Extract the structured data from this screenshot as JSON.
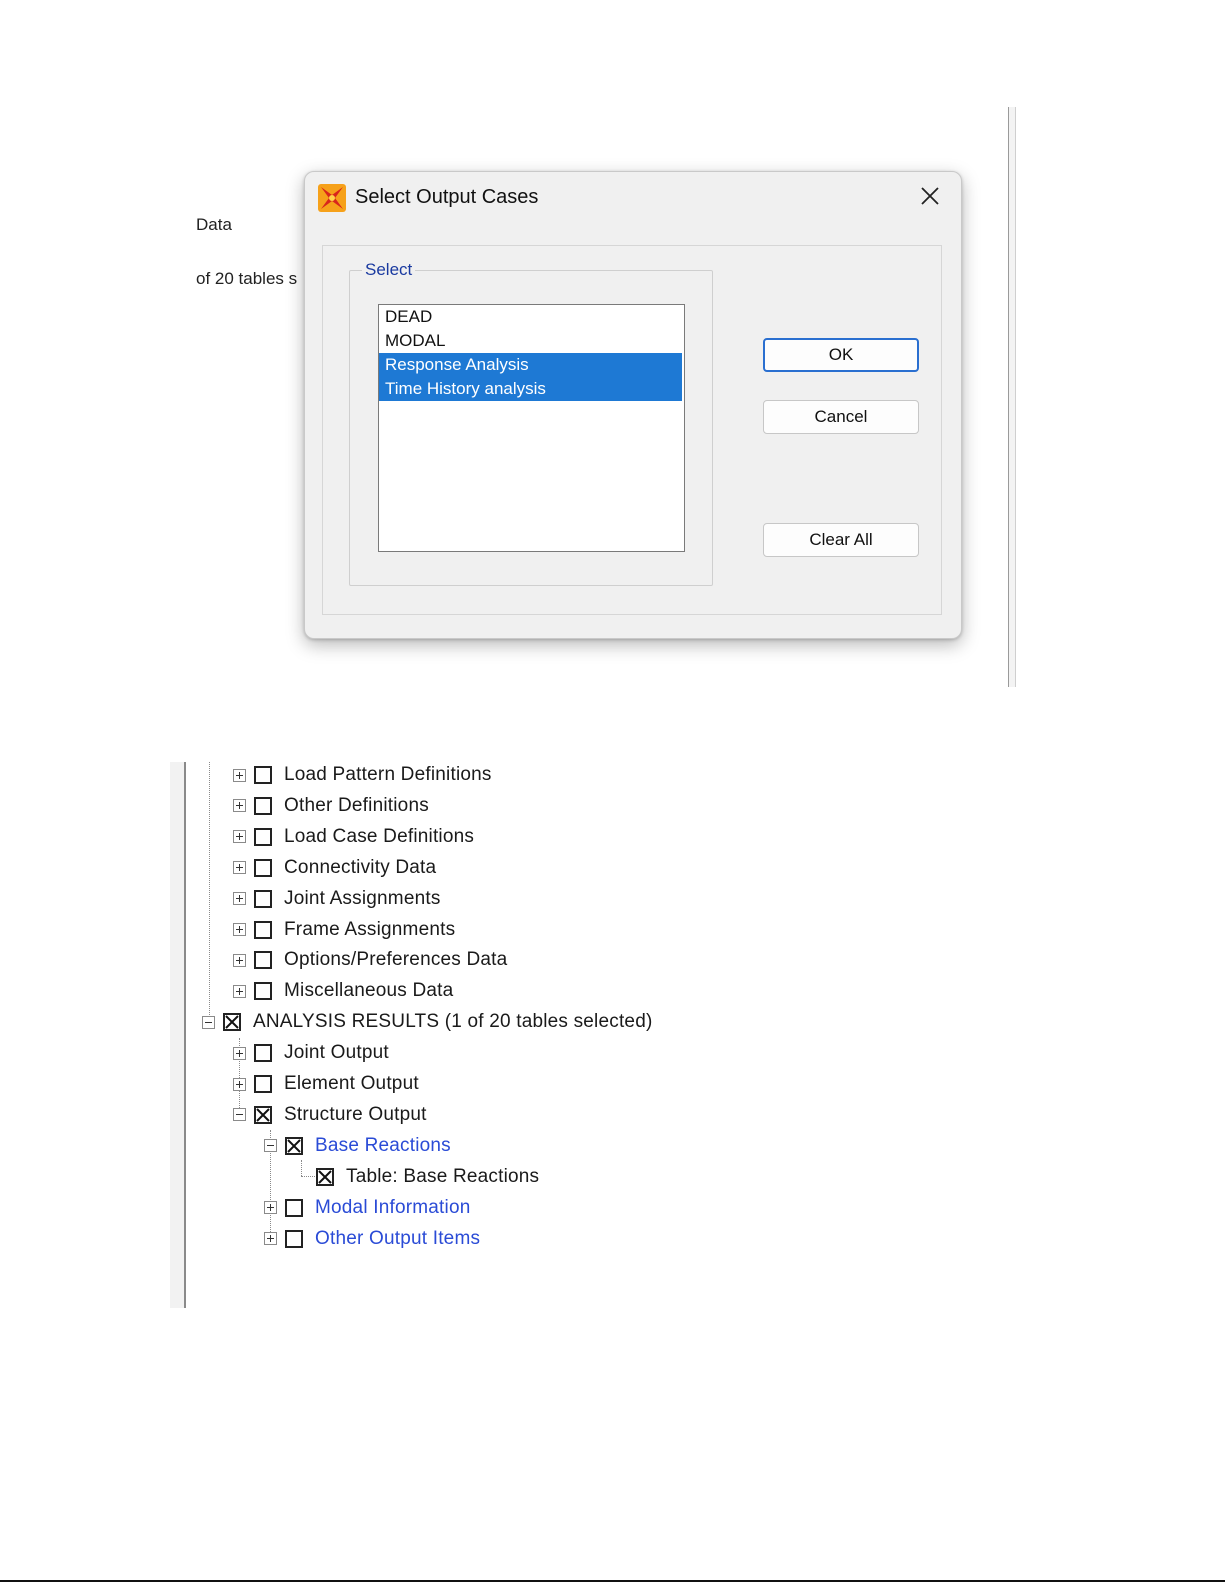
{
  "background_window": {
    "text_line_1": "Data",
    "text_line_2": "of 20 tables s"
  },
  "dialog": {
    "title": "Select Output Cases",
    "icon": "sap2000-app-icon",
    "close_icon": "close-icon",
    "group_label": "Select",
    "cases": [
      {
        "label": "DEAD",
        "selected": false
      },
      {
        "label": "MODAL",
        "selected": false
      },
      {
        "label": "Response Analysis",
        "selected": true
      },
      {
        "label": "Time History analysis",
        "selected": true
      }
    ],
    "buttons": {
      "ok": "OK",
      "cancel": "Cancel",
      "clear_all": "Clear All"
    },
    "colors": {
      "selection": "#1e79d4",
      "group_label": "#1a3aa0",
      "primary_border": "#2a6fd0"
    }
  },
  "tree": {
    "nodes": [
      {
        "label": "Load Pattern Definitions",
        "expander": "plus",
        "checked": false,
        "link": false
      },
      {
        "label": "Other Definitions",
        "expander": "plus",
        "checked": false,
        "link": false
      },
      {
        "label": "Load Case Definitions",
        "expander": "plus",
        "checked": false,
        "link": false
      },
      {
        "label": "Connectivity Data",
        "expander": "plus",
        "checked": false,
        "link": false
      },
      {
        "label": "Joint Assignments",
        "expander": "plus",
        "checked": false,
        "link": false
      },
      {
        "label": "Frame Assignments",
        "expander": "plus",
        "checked": false,
        "link": false
      },
      {
        "label": "Options/Preferences Data",
        "expander": "plus",
        "checked": false,
        "link": false
      },
      {
        "label": "Miscellaneous Data",
        "expander": "plus",
        "checked": false,
        "link": false
      },
      {
        "label": "ANALYSIS RESULTS  (1 of 20 tables selected)",
        "expander": "minus",
        "checked": true,
        "link": false
      },
      {
        "label": "Joint Output",
        "expander": "plus",
        "checked": false,
        "link": false
      },
      {
        "label": "Element Output",
        "expander": "plus",
        "checked": false,
        "link": false
      },
      {
        "label": "Structure Output",
        "expander": "minus",
        "checked": true,
        "link": false
      },
      {
        "label": "Base Reactions",
        "expander": "minus",
        "checked": true,
        "link": true
      },
      {
        "label": "Table:  Base Reactions",
        "expander": "none",
        "checked": true,
        "link": false
      },
      {
        "label": "Modal Information",
        "expander": "plus",
        "checked": false,
        "link": true
      },
      {
        "label": "Other Output Items",
        "expander": "plus",
        "checked": false,
        "link": true
      }
    ],
    "colors": {
      "link": "#2a4bd6"
    }
  }
}
